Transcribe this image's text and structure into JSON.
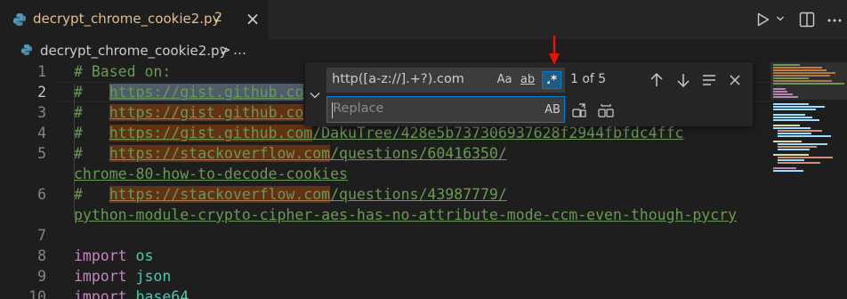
{
  "tab": {
    "title": "decrypt_chrome_cookie2.py",
    "problem_count": "2",
    "close": "×"
  },
  "breadcrumb": {
    "file": "decrypt_chrome_cookie2.py",
    "separator": ">",
    "more": "…"
  },
  "editor": {
    "line_numbers": [
      "1",
      "2",
      "3",
      "4",
      "5",
      "",
      "6",
      "",
      "7",
      "8",
      "9",
      "10"
    ],
    "lines": {
      "l1": "# Based on:",
      "l2_hash": "#   ",
      "l2_url": "https://gist.github.co",
      "l3_hash": "#   ",
      "l3_url": "https://gist.github.co",
      "l4_hash": "#   ",
      "l4_url_match": "https://gist.github.com",
      "l4_url_rest": "/DakuTree/428e5b737306937628f2944fbfdc4ffc",
      "l5_hash": "#   ",
      "l5_url_match": "https://stackoverflow.com",
      "l5_url_rest": "/questions/60416350/",
      "l5_wrap": "chrome-80-how-to-decode-cookies",
      "l6_hash": "#   ",
      "l6_url_match": "https://stackoverflow.com",
      "l6_url_rest": "/questions/43987779/",
      "l6_wrap": "python-module-crypto-cipher-aes-has-no-attribute-mode-ccm-even-though-pycry",
      "l8_kw": "import",
      "l8_mod": "os",
      "l9_kw": "import",
      "l9_mod": "json",
      "l10_kw": "import",
      "l10_mod": "base64"
    }
  },
  "find_widget": {
    "search_value": "http([a-z://].+?).com",
    "match_case_label": "Aa",
    "whole_word_label": "ab",
    "regex_label": ".*",
    "result_count": "1 of 5",
    "replace_placeholder": "Replace",
    "preserve_case_label": "AB"
  },
  "colors": {
    "accent": "#007acc",
    "annotation_arrow": "#e51400"
  }
}
